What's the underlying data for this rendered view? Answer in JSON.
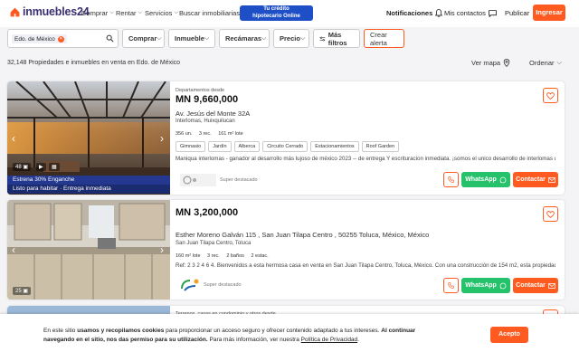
{
  "header": {
    "logo_text": "inmuebles24",
    "nav": [
      "Comprar",
      "Rentar",
      "Servicios",
      "Buscar inmobiliarias"
    ],
    "credit_line1": "Tu crédito",
    "credit_line2": "hipotecario Online",
    "notifications": "Notificaciones",
    "contacts": "Mis contactos",
    "publish": "Publicar",
    "login": "Ingresar"
  },
  "filters": {
    "location_chip": "Edo. de México",
    "buttons": [
      "Comprar",
      "Inmueble",
      "Recámaras",
      "Precio"
    ],
    "more_filters": "Más filtros",
    "create_alert": "Crear alerta"
  },
  "results": {
    "summary": "32,148 Propiedades e inmuebles en venta en Edo. de México",
    "map": "Ver mapa",
    "sort": "Ordenar"
  },
  "listings": [
    {
      "type": "Departamentos desde",
      "price": "MN 9,660,000",
      "address": "Av. Jesús del Monte 32A",
      "location": "Interlomas, Huixquilucan",
      "features": [
        "356 un.",
        "3 rec.",
        "161 m² lote"
      ],
      "tags": [
        "Gimnasio",
        "Jardín",
        "Alberca",
        "Circuito Cerrado",
        "Estacionamientos",
        "Roof Garden"
      ],
      "description": "Maniqua interlomas - ganador al desarrollo más lujoso de méxico 2023 -- de entrega Y escrituracion inmediata. ¡somos el unico desarrollo de interlomas que t...",
      "photos": "48",
      "banner1": "Estrena 30% Enganche",
      "banner2": "Listo para habitar · Entrega inmediata",
      "publisher_label": "Super destacado",
      "whatsapp": "WhatsApp",
      "contact": "Contactar"
    },
    {
      "type": "",
      "price": "MN 3,200,000",
      "address": "Esther Moreno Galván 115 , San Juan Tilapa Centro , 50255 Toluca, México, México",
      "location": "San Juan Tilapa Centro, Toluca",
      "features": [
        "160 m² lote",
        "3 rec.",
        "2 baños",
        "2 estac."
      ],
      "tags": [],
      "description": "Ref: 2 3 2 4 6 4. Bienvenidos a esta hermosa casa en venta en San Juan Tilapa Centro, Toluca, México. Con una construcción de 154 m2, esta propiedad cuenta...",
      "photos": "25",
      "publisher_label": "Super destacado",
      "whatsapp": "WhatsApp",
      "contact": "Contactar"
    },
    {
      "type": "Terrenos, casas en condominio y otros desde"
    }
  ],
  "cookie": {
    "t1": "En este sitio ",
    "b1": "usamos y recopilamos cookies",
    "t2": " para proporcionar un acceso seguro y ofrecer contenido adaptado a tus intereses. ",
    "b2": "Al continuar navegando en el sitio, nos das permiso para su utilización.",
    "t3": " Para más información, ver nuestra ",
    "link": "Política de Privacidad",
    "t4": ".",
    "accept": "Acepto"
  }
}
